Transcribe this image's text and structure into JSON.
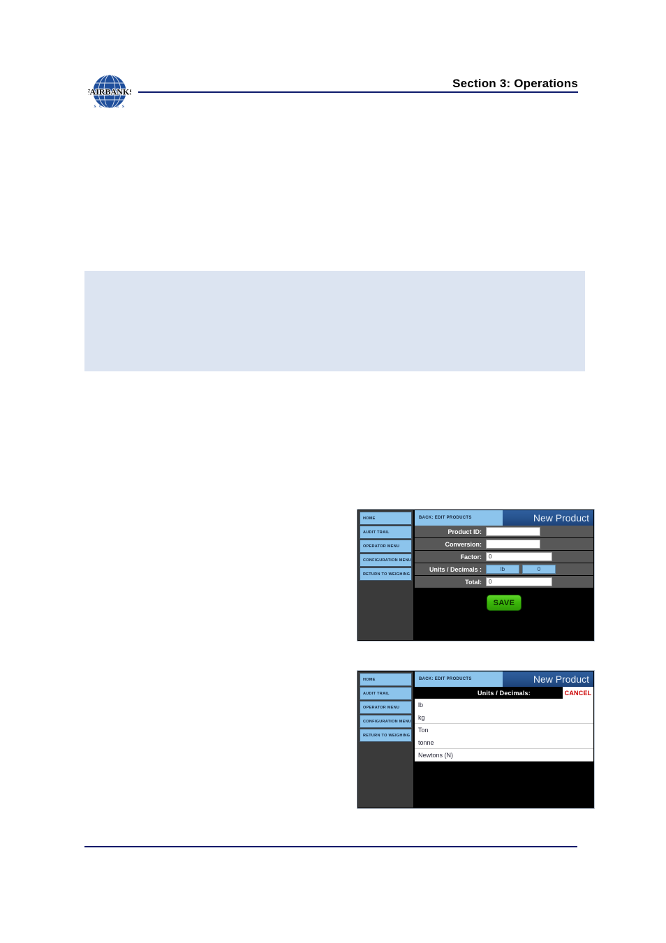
{
  "page": {
    "section_title": "Section 3:  Operations",
    "logo_wordmark": "FAIRBANKS",
    "logo_subtext": "S C A L E S",
    "note_text": ""
  },
  "colors": {
    "rule_navy": "#0d1a6b",
    "note_background": "#dce4f1",
    "sidebar_item": "#8cc4ec",
    "titlebar_back": "#8cc4ec",
    "titlebar_title": "#27548f",
    "save_green": "#3cb80a",
    "cancel_red": "#cc0000"
  },
  "device_new_product": {
    "sidebar": {
      "items": [
        {
          "label": "HOME"
        },
        {
          "label": "AUDIT TRAIL"
        },
        {
          "label": "OPERATOR MENU"
        },
        {
          "label": "CONFIGURATION MENU"
        },
        {
          "label": "RETURN TO WEIGHING"
        }
      ]
    },
    "titlebar": {
      "back_label": "BACK: EDIT PRODUCTS",
      "title": "New Product"
    },
    "form": {
      "rows": [
        {
          "label": "Product ID:",
          "value": ""
        },
        {
          "label": "Conversion:",
          "value": ""
        },
        {
          "label": "Factor:",
          "value": "0"
        },
        {
          "label": "Units /  Decimals :",
          "unit_value": "lb",
          "decimals_value": "0"
        },
        {
          "label": "Total:",
          "value": "0"
        }
      ]
    },
    "save_label": "SAVE"
  },
  "device_units_list": {
    "sidebar": {
      "items": [
        {
          "label": "HOME"
        },
        {
          "label": "AUDIT TRAIL"
        },
        {
          "label": "OPERATOR MENU"
        },
        {
          "label": "CONFIGURATION MENU"
        },
        {
          "label": "RETURN TO WEIGHING"
        }
      ]
    },
    "titlebar": {
      "back_label": "BACK: EDIT PRODUCTS",
      "title": "New Product"
    },
    "picker": {
      "title": "Units / Decimals:",
      "cancel_label": "CANCEL",
      "options": [
        {
          "label": "lb"
        },
        {
          "label": "kg"
        },
        {
          "label": "Ton"
        },
        {
          "label": "tonne"
        },
        {
          "label": "Newtons (N)"
        }
      ]
    }
  }
}
